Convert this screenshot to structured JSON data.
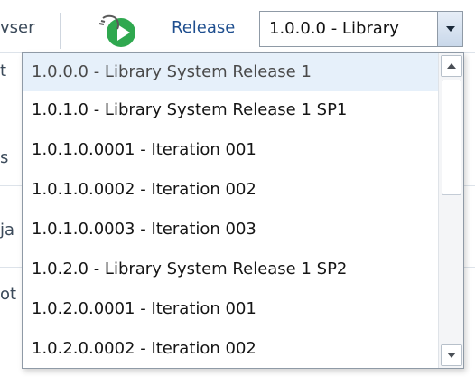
{
  "toolbar": {
    "browser_partial": "vser",
    "release_label": "Release",
    "release_selected": "1.0.0.0 - Library"
  },
  "left_hints": {
    "t": "t",
    "s": "s",
    "ja": "ja",
    "ot": "ot"
  },
  "dropdown": {
    "items": [
      {
        "label": "1.0.0.0 - Library System Release 1",
        "selected": true
      },
      {
        "label": "1.0.1.0 - Library System Release 1 SP1",
        "selected": false
      },
      {
        "label": "1.0.1.0.0001 - Iteration 001",
        "selected": false
      },
      {
        "label": "1.0.1.0.0002 - Iteration 002",
        "selected": false
      },
      {
        "label": "1.0.1.0.0003 - Iteration 003",
        "selected": false
      },
      {
        "label": "1.0.2.0 - Library System Release 1 SP2",
        "selected": false
      },
      {
        "label": "1.0.2.0.0001 - Iteration 001",
        "selected": false
      },
      {
        "label": "1.0.2.0.0002 - Iteration 002",
        "selected": false
      }
    ]
  },
  "icons": {
    "play": "play-icon",
    "up": "scroll-up-arrow-icon",
    "down": "scroll-down-arrow-icon",
    "select_arrow": "chevron-down-icon"
  },
  "colors": {
    "accent_green": "#2fa84f",
    "label_blue": "#1f4f8f",
    "selected_bg": "#e6f0fa"
  }
}
